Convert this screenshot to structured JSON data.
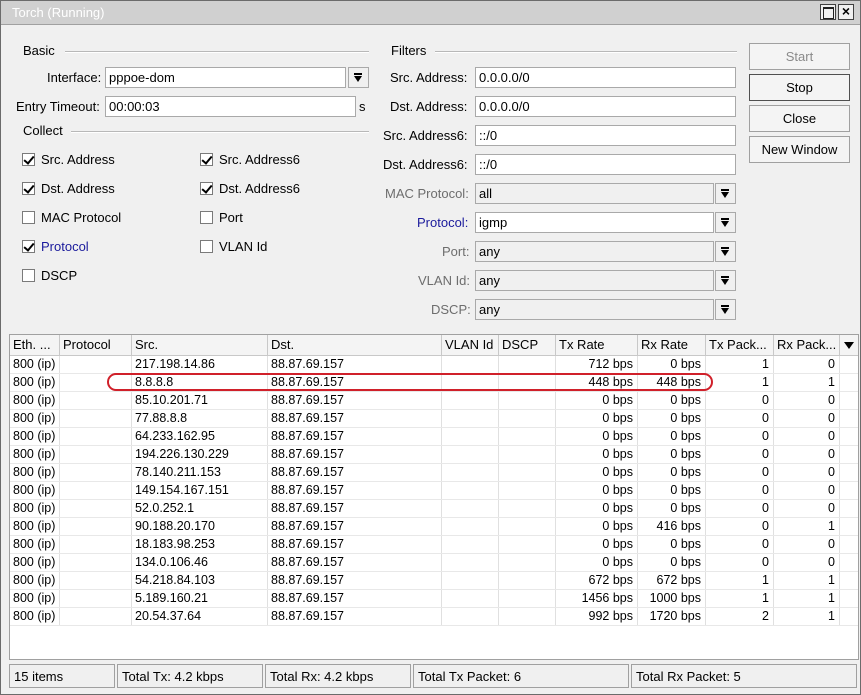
{
  "window": {
    "title": "Torch (Running)"
  },
  "basic": {
    "section": "Basic",
    "interface_label": "Interface:",
    "interface_value": "pppoe-dom",
    "timeout_label": "Entry Timeout:",
    "timeout_value": "00:00:03",
    "timeout_unit": "s"
  },
  "collect": {
    "section": "Collect",
    "items": [
      {
        "label": "Src. Address",
        "checked": true
      },
      {
        "label": "Src. Address6",
        "checked": true
      },
      {
        "label": "Dst. Address",
        "checked": true
      },
      {
        "label": "Dst. Address6",
        "checked": true
      },
      {
        "label": "MAC Protocol",
        "checked": false
      },
      {
        "label": "Port",
        "checked": false
      },
      {
        "label": "Protocol",
        "checked": true
      },
      {
        "label": "VLAN Id",
        "checked": false
      },
      {
        "label": "DSCP",
        "checked": false
      }
    ]
  },
  "filters": {
    "section": "Filters",
    "src_address": {
      "label": "Src. Address:",
      "value": "0.0.0.0/0"
    },
    "dst_address": {
      "label": "Dst. Address:",
      "value": "0.0.0.0/0"
    },
    "src_address6": {
      "label": "Src. Address6:",
      "value": "::/0"
    },
    "dst_address6": {
      "label": "Dst. Address6:",
      "value": "::/0"
    },
    "mac_protocol": {
      "label": "MAC Protocol:",
      "value": "all"
    },
    "protocol": {
      "label": "Protocol:",
      "value": "igmp"
    },
    "port": {
      "label": "Port:",
      "value": "any"
    },
    "vlan_id": {
      "label": "VLAN Id:",
      "value": "any"
    },
    "dscp": {
      "label": "DSCP:",
      "value": "any"
    }
  },
  "buttons": {
    "start": "Start",
    "stop": "Stop",
    "close": "Close",
    "new_window": "New Window"
  },
  "table": {
    "columns": [
      "Eth. ...",
      "Protocol",
      "Src.",
      "Dst.",
      "VLAN Id",
      "DSCP",
      "Tx Rate",
      "Rx Rate",
      "Tx Pack...",
      "Rx Pack..."
    ],
    "rows": [
      [
        "800 (ip)",
        "",
        "217.198.14.86",
        "88.87.69.157",
        "",
        "",
        "712 bps",
        "0 bps",
        "1",
        "0"
      ],
      [
        "800 (ip)",
        "",
        "8.8.8.8",
        "88.87.69.157",
        "",
        "",
        "448 bps",
        "448 bps",
        "1",
        "1"
      ],
      [
        "800 (ip)",
        "",
        "85.10.201.71",
        "88.87.69.157",
        "",
        "",
        "0 bps",
        "0 bps",
        "0",
        "0"
      ],
      [
        "800 (ip)",
        "",
        "77.88.8.8",
        "88.87.69.157",
        "",
        "",
        "0 bps",
        "0 bps",
        "0",
        "0"
      ],
      [
        "800 (ip)",
        "",
        "64.233.162.95",
        "88.87.69.157",
        "",
        "",
        "0 bps",
        "0 bps",
        "0",
        "0"
      ],
      [
        "800 (ip)",
        "",
        "194.226.130.229",
        "88.87.69.157",
        "",
        "",
        "0 bps",
        "0 bps",
        "0",
        "0"
      ],
      [
        "800 (ip)",
        "",
        "78.140.211.153",
        "88.87.69.157",
        "",
        "",
        "0 bps",
        "0 bps",
        "0",
        "0"
      ],
      [
        "800 (ip)",
        "",
        "149.154.167.151",
        "88.87.69.157",
        "",
        "",
        "0 bps",
        "0 bps",
        "0",
        "0"
      ],
      [
        "800 (ip)",
        "",
        "52.0.252.1",
        "88.87.69.157",
        "",
        "",
        "0 bps",
        "0 bps",
        "0",
        "0"
      ],
      [
        "800 (ip)",
        "",
        "90.188.20.170",
        "88.87.69.157",
        "",
        "",
        "0 bps",
        "416 bps",
        "0",
        "1"
      ],
      [
        "800 (ip)",
        "",
        "18.183.98.253",
        "88.87.69.157",
        "",
        "",
        "0 bps",
        "0 bps",
        "0",
        "0"
      ],
      [
        "800 (ip)",
        "",
        "134.0.106.46",
        "88.87.69.157",
        "",
        "",
        "0 bps",
        "0 bps",
        "0",
        "0"
      ],
      [
        "800 (ip)",
        "",
        "54.218.84.103",
        "88.87.69.157",
        "",
        "",
        "672 bps",
        "672 bps",
        "1",
        "1"
      ],
      [
        "800 (ip)",
        "",
        "5.189.160.21",
        "88.87.69.157",
        "",
        "",
        "1456 bps",
        "1000 bps",
        "1",
        "1"
      ],
      [
        "800 (ip)",
        "",
        "20.54.37.64",
        "88.87.69.157",
        "",
        "",
        "992 bps",
        "1720 bps",
        "2",
        "1"
      ]
    ]
  },
  "status": {
    "items": "15 items",
    "total_tx": "Total Tx: 4.2 kbps",
    "total_rx": "Total Rx: 4.2 kbps",
    "total_tx_packet": "Total Tx Packet: 6",
    "total_rx_packet": "Total Rx Packet: 5"
  }
}
